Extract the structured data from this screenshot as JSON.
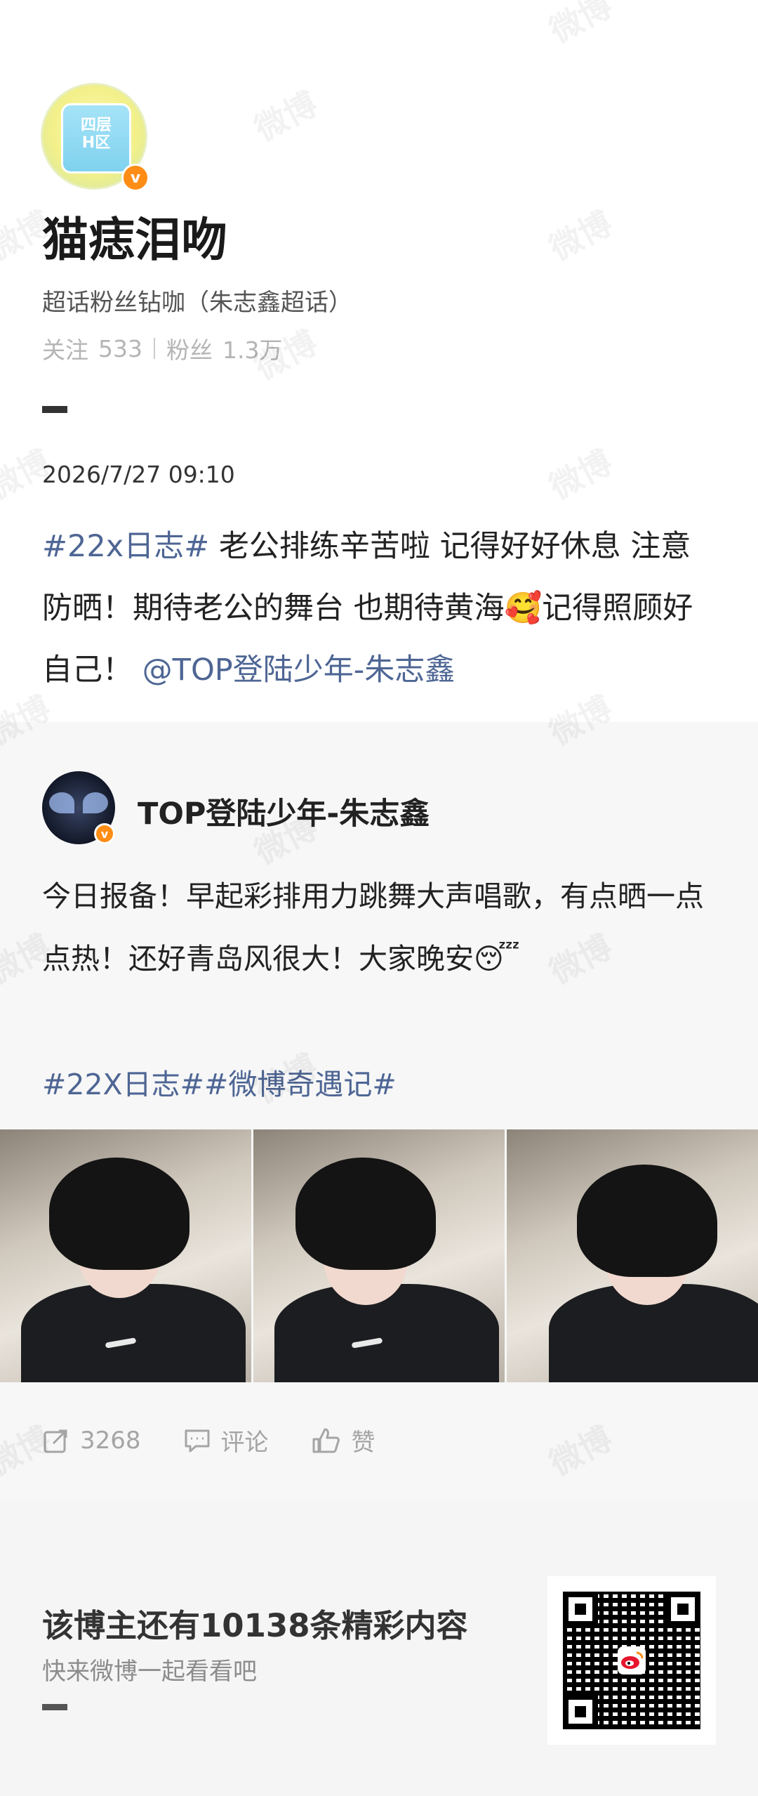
{
  "profile": {
    "avatar_text": "四层\nH区",
    "verified_mark": "v",
    "name": "猫痣泪吻",
    "supertopic": "超话粉丝钻咖（朱志鑫超话）",
    "following_label": "关注",
    "following_count": "533",
    "followers_label": "粉丝",
    "followers_count": "1.3万"
  },
  "post": {
    "timestamp": "2026/7/27 09:10",
    "hashtag": "#22x日志#",
    "text_main": " 老公排练辛苦啦 记得好好休息 注意防晒！期待老公的舞台 也期待黄海",
    "emoji": "🥰",
    "text_after_emoji": "记得照顾好自己！",
    "mention": "@TOP登陆少年-朱志鑫"
  },
  "repost": {
    "author": "TOP登陆少年-朱志鑫",
    "verified_mark": "v",
    "text": "今日报备！早起彩排用力跳舞大声唱歌，有点晒一点点热！还好青岛风很大！大家晚安",
    "emoji": "😴",
    "tags": "#22X日志##微博奇遇记#",
    "photos": [
      "photo-1",
      "photo-2",
      "photo-3"
    ]
  },
  "actions": {
    "repost_count": "3268",
    "comment_label": "评论",
    "like_label": "赞"
  },
  "footer": {
    "title": "该博主还有10138条精彩内容",
    "subtitle": "快来微博一起看看吧"
  },
  "watermark_text": "微博",
  "icons": [
    "share-icon",
    "comment-icon",
    "like-icon",
    "qr-code",
    "weibo-logo-icon"
  ]
}
